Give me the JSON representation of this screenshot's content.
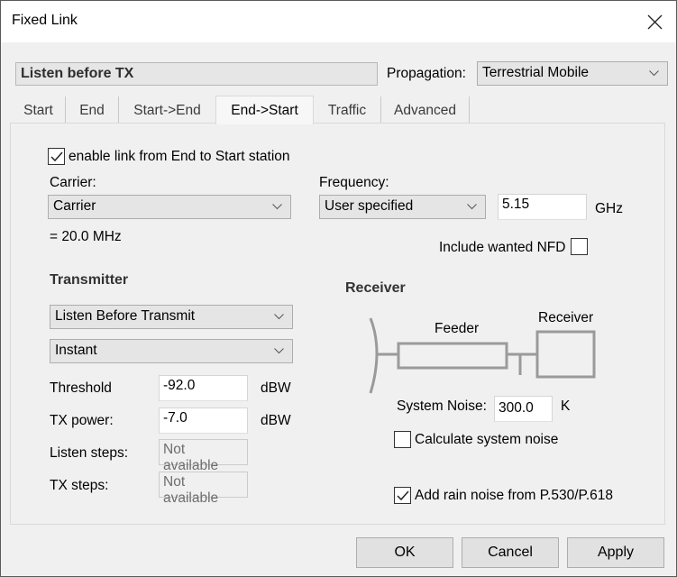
{
  "window": {
    "title": "Fixed Link",
    "close_icon": "close-icon"
  },
  "header": {
    "link_name": "Listen before TX",
    "propagation_label": "Propagation:",
    "propagation_value": "Terrestrial Mobile"
  },
  "tabs": [
    {
      "label": "Start",
      "active": false
    },
    {
      "label": "End",
      "active": false
    },
    {
      "label": "Start->End",
      "active": false
    },
    {
      "label": "End->Start",
      "active": true
    },
    {
      "label": "Traffic",
      "active": false
    },
    {
      "label": "Advanced",
      "active": false
    }
  ],
  "panel": {
    "enable_link": {
      "label": "enable link from End to Start station",
      "checked": true
    },
    "carrier": {
      "label": "Carrier:",
      "value": "Carrier",
      "bandwidth": "= 20.0 MHz"
    },
    "frequency": {
      "label": "Frequency:",
      "mode": "User specified",
      "value": "5.15",
      "unit": "GHz"
    },
    "include_nfd": {
      "label": "Include wanted NFD",
      "checked": false
    },
    "transmitter": {
      "heading": "Transmitter",
      "mode": "Listen Before Transmit",
      "timing": "Instant",
      "threshold": {
        "label": "Threshold",
        "value": "-92.0",
        "unit": "dBW"
      },
      "tx_power": {
        "label": "TX power:",
        "value": "-7.0",
        "unit": "dBW"
      },
      "listen_steps": {
        "label": "Listen steps:",
        "value": "Not available"
      },
      "tx_steps": {
        "label": "TX steps:",
        "value": "Not available"
      }
    },
    "receiver": {
      "heading": "Receiver",
      "diagram": {
        "feeder_label": "Feeder",
        "receiver_label": "Receiver"
      },
      "system_noise": {
        "label": "System Noise:",
        "value": "300.0",
        "unit": "K"
      },
      "calculate_noise": {
        "label": "Calculate system noise",
        "checked": false
      },
      "rain_noise": {
        "label": "Add rain noise from P.530/P.618",
        "checked": true
      }
    }
  },
  "buttons": {
    "ok": "OK",
    "cancel": "Cancel",
    "apply": "Apply"
  }
}
